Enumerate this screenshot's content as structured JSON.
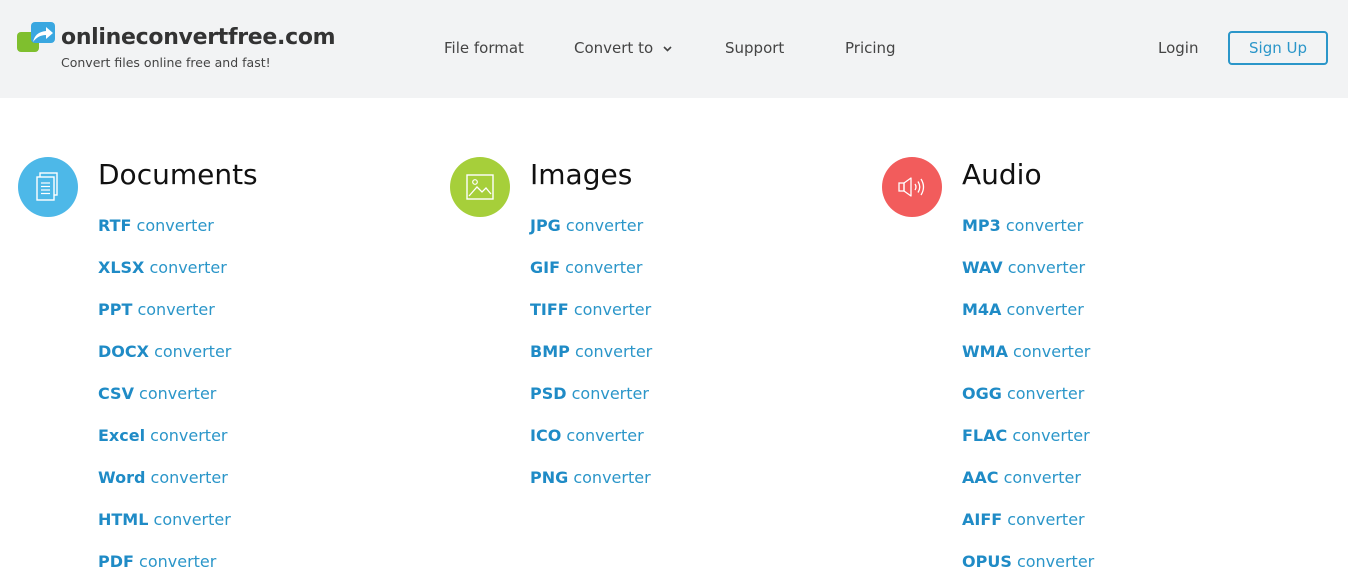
{
  "header": {
    "logo_name": "onlineconvertfree.com",
    "tagline": "Convert files online free and fast!",
    "nav": [
      {
        "label": "File format"
      },
      {
        "label": "Convert to"
      },
      {
        "label": "Support"
      },
      {
        "label": "Pricing"
      }
    ],
    "login_label": "Login",
    "signup_label": "Sign Up"
  },
  "converter_suffix": "converter",
  "categories": [
    {
      "title": "Documents",
      "icon": "document-icon",
      "color": "#4db8e8",
      "items": [
        "RTF",
        "XLSX",
        "PPT",
        "DOCX",
        "CSV",
        "Excel",
        "Word",
        "HTML",
        "PDF"
      ]
    },
    {
      "title": "Images",
      "icon": "image-icon",
      "color": "#a6cf3a",
      "items": [
        "JPG",
        "GIF",
        "TIFF",
        "BMP",
        "PSD",
        "ICO",
        "PNG"
      ]
    },
    {
      "title": "Audio",
      "icon": "speaker-icon",
      "color": "#f25c5c",
      "items": [
        "MP3",
        "WAV",
        "M4A",
        "WMA",
        "OGG",
        "FLAC",
        "AAC",
        "AIFF",
        "OPUS"
      ]
    }
  ],
  "colors": {
    "link": "#2b96c9",
    "header_bg": "#f2f3f4"
  }
}
